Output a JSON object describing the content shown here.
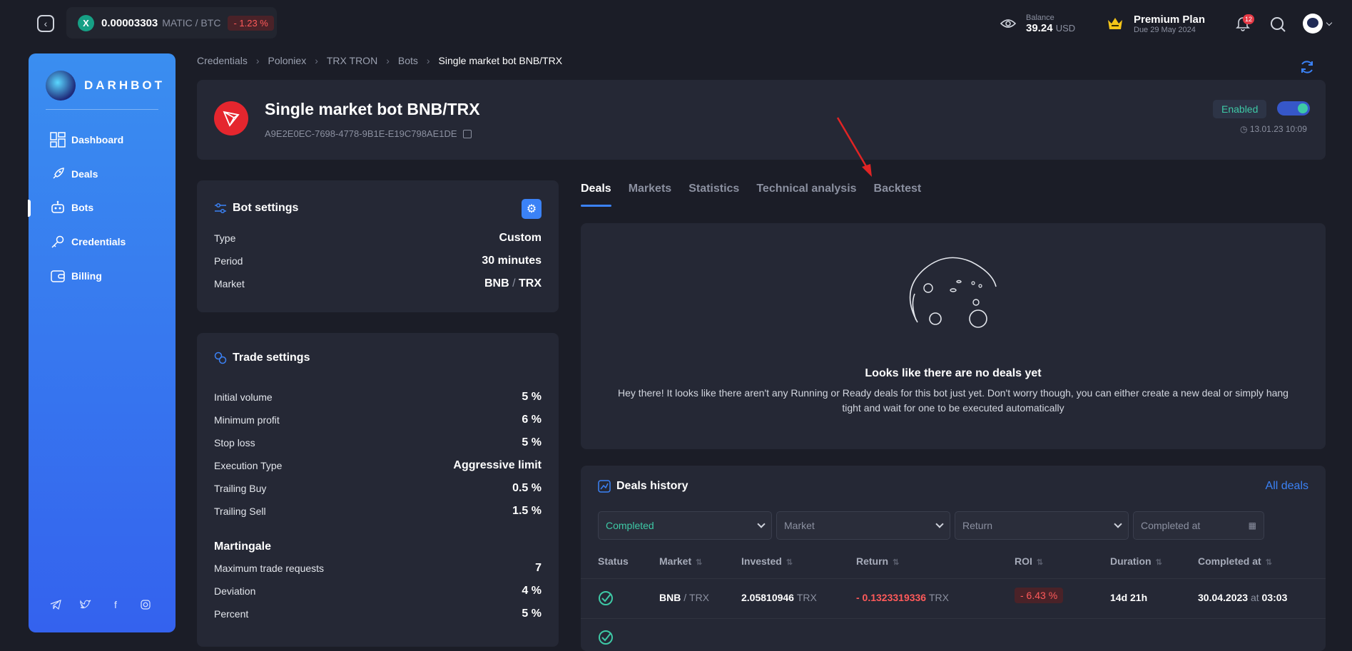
{
  "ticker": {
    "price": "0.00003303",
    "pair": "MATIC / BTC",
    "change": "- 1.23 %",
    "coin_letter": "X"
  },
  "balance": {
    "label": "Balance",
    "value": "39.24",
    "unit": "USD"
  },
  "plan": {
    "name": "Premium Plan",
    "due": "Due 29 May 2024"
  },
  "notifications": {
    "count": "12"
  },
  "brand": {
    "name": "DARHBOT"
  },
  "nav": [
    {
      "label": "Dashboard",
      "icon": "dashboard-icon"
    },
    {
      "label": "Deals",
      "icon": "rocket-icon"
    },
    {
      "label": "Bots",
      "icon": "robot-icon"
    },
    {
      "label": "Credentials",
      "icon": "key-icon"
    },
    {
      "label": "Billing",
      "icon": "wallet-icon"
    }
  ],
  "breadcrumb": [
    "Credentials",
    "Poloniex",
    "TRX TRON",
    "Bots",
    "Single market bot BNB/TRX"
  ],
  "bot": {
    "title": "Single market bot BNB/TRX",
    "id": "A9E2E0EC-7698-4778-9B1E-E19C798AE1DE",
    "status": "Enabled",
    "timestamp": "13.01.23 10:09"
  },
  "bot_settings": {
    "title": "Bot settings",
    "rows": [
      {
        "label": "Type",
        "value": "Custom"
      },
      {
        "label": "Period",
        "value": "30 minutes"
      },
      {
        "label": "Market",
        "base": "BNB",
        "sep": "/",
        "quote": "TRX"
      }
    ]
  },
  "trade_settings": {
    "title": "Trade settings",
    "rows": [
      {
        "label": "Initial volume",
        "value": "5 %"
      },
      {
        "label": "Minimum profit",
        "value": "6 %"
      },
      {
        "label": "Stop loss",
        "value": "5 %"
      },
      {
        "label": "Execution Type",
        "value": "Aggressive limit"
      },
      {
        "label": "Trailing Buy",
        "value": "0.5 %"
      },
      {
        "label": "Trailing Sell",
        "value": "1.5 %"
      }
    ],
    "martingale_title": "Martingale",
    "martingale_rows": [
      {
        "label": "Maximum trade requests",
        "value": "7"
      },
      {
        "label": "Deviation",
        "value": "4 %"
      },
      {
        "label": "Percent",
        "value": "5 %"
      }
    ]
  },
  "tabs": [
    "Deals",
    "Markets",
    "Statistics",
    "Technical analysis",
    "Backtest"
  ],
  "empty_state": {
    "title": "Looks like there are no deals yet",
    "desc": "Hey there! It looks like there aren't any Running or Ready deals for this bot just yet. Don't worry though, you can either create a new deal or simply hang tight and wait for one to be executed automatically"
  },
  "history": {
    "title": "Deals history",
    "all_link": "All deals",
    "filters": {
      "status": "Completed",
      "market": "Market",
      "return": "Return",
      "completed_at": "Completed at"
    },
    "columns": [
      "Status",
      "Market",
      "Invested",
      "Return",
      "ROI",
      "Duration",
      "Completed at"
    ],
    "rows": [
      {
        "market_base": "BNB",
        "market_quote": "TRX",
        "invested": "2.05810946",
        "invested_unit": "TRX",
        "return": "- 0.1323319336",
        "return_unit": "TRX",
        "roi": "- 6.43 %",
        "duration": "14d 21h",
        "date": "30.04.2023",
        "at": "at",
        "time": "03:03"
      }
    ]
  }
}
